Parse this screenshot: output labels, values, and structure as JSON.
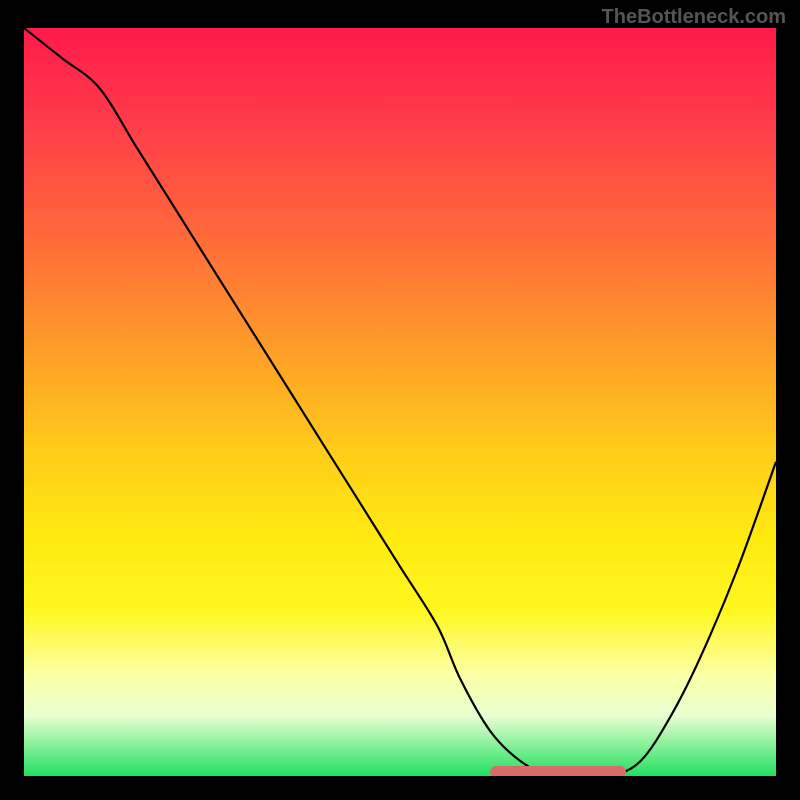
{
  "watermark": "TheBottleneck.com",
  "colors": {
    "curve": "#000000",
    "highlight": "#d86b6b"
  },
  "chart_data": {
    "type": "line",
    "title": "",
    "xlabel": "",
    "ylabel": "",
    "xlim": [
      0,
      100
    ],
    "ylim": [
      0,
      100
    ],
    "series": [
      {
        "name": "bottleneck-curve",
        "x": [
          0,
          5,
          10,
          15,
          20,
          25,
          30,
          35,
          40,
          45,
          50,
          55,
          58,
          62,
          66,
          70,
          74,
          78,
          82,
          86,
          90,
          95,
          100
        ],
        "y": [
          100,
          96,
          92,
          84,
          76,
          68,
          60,
          52,
          44,
          36,
          28,
          20,
          13,
          6,
          2,
          0,
          0,
          0,
          2,
          8,
          16,
          28,
          42
        ]
      }
    ],
    "highlight_segment": {
      "x_start": 62,
      "x_end": 80,
      "y": 0
    },
    "annotations": []
  }
}
